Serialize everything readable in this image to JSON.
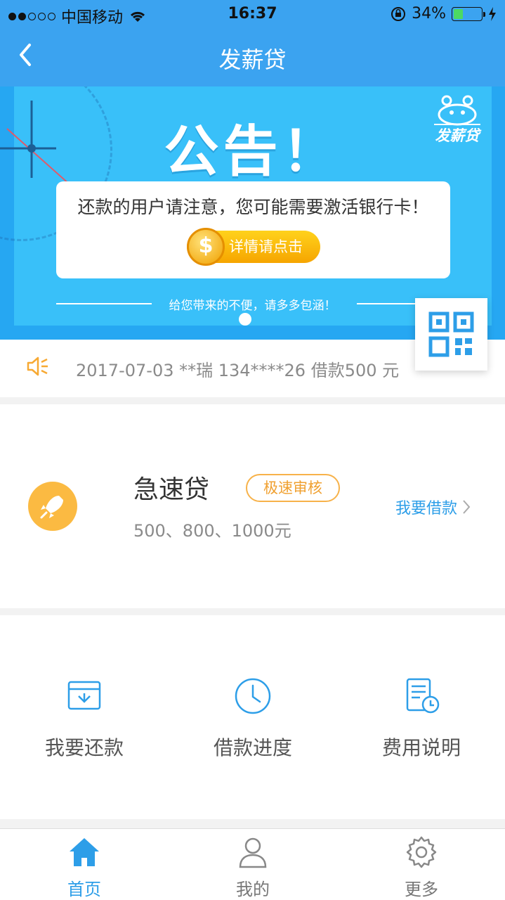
{
  "status_bar": {
    "carrier": "中国移动",
    "time": "16:37",
    "battery_percent": "34%",
    "battery_level": 0.34
  },
  "nav": {
    "title": "发薪贷",
    "back_icon": "chevron-left-icon"
  },
  "banner": {
    "announcement_title": "公告！",
    "notice_text": "还款的用户请注意，您可能需要激活银行卡！",
    "detail_button": "详情请点击",
    "coin_symbol": "$",
    "apology_text": "给您带来的不便，请多多包涵！",
    "brand_logo_text": "发薪贷",
    "active_slide": 1,
    "slide_count": 1
  },
  "ticker": {
    "icon": "speaker-icon",
    "message": "2017-07-03 **瑞 134****26 借款500 元"
  },
  "loan_product": {
    "icon": "rocket-icon",
    "name": "急速贷",
    "badge": "极速审核",
    "amounts": "500、800、1000元",
    "action_label": "我要借款"
  },
  "actions": [
    {
      "label": "我要还款",
      "icon": "repay-card-icon"
    },
    {
      "label": "借款进度",
      "icon": "clock-icon"
    },
    {
      "label": "费用说明",
      "icon": "document-clock-icon"
    }
  ],
  "tabbar": {
    "tabs": [
      {
        "label": "首页",
        "icon": "home-icon",
        "active": true
      },
      {
        "label": "我的",
        "icon": "user-icon",
        "active": false
      },
      {
        "label": "更多",
        "icon": "gear-icon",
        "active": false
      }
    ]
  },
  "colors": {
    "nav_blue": "#3ba3f0",
    "banner_blue": "#39c0f9",
    "accent_blue": "#2d9ee8",
    "orange": "#fbba42"
  }
}
